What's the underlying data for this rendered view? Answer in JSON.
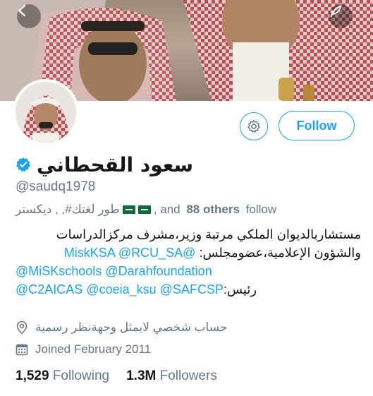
{
  "profile": {
    "display_name": "سعود القحطاني",
    "verified": true,
    "handle": "@saudq1978"
  },
  "actions": {
    "follow_label": "Follow",
    "settings_icon": "gear-icon",
    "back_icon": "chevron-left-icon",
    "compose_icon": "feather-icon"
  },
  "followed_by": {
    "names": "طور لغتك#, , دیکستر",
    "suffix_pre": ", and ",
    "others": "88 others",
    "suffix_post": " follow"
  },
  "bio": {
    "line1": "مستشاربالديوان الملكي مرتبة وزير،مشرف مركزالدراسات",
    "line2_text": "والشؤون الإعلامية،عضومجلس:",
    "line2_mentions": [
      "@MiskKSA",
      "@RCU_SA"
    ],
    "line3_mentions": [
      "@MiSKschools",
      "@Darahfoundation"
    ],
    "line4_mentions": [
      "@C2AICAS",
      "@coeia_ksu",
      "@SAFCSP"
    ],
    "line4_text": ":رئيس"
  },
  "meta": {
    "location": "حساب شخصي لايمثل وجهةنظر رسمية",
    "location_icon": "location-pin-icon",
    "joined": "Joined February 2011",
    "joined_icon": "calendar-icon"
  },
  "stats": {
    "following_count": "1,529",
    "following_label": "Following",
    "followers_count": "1.3M",
    "followers_label": "Followers"
  },
  "colors": {
    "accent": "#1da1f2",
    "secondary_text": "#657786",
    "primary_text": "#14171a",
    "verified": "#1da1f2"
  }
}
